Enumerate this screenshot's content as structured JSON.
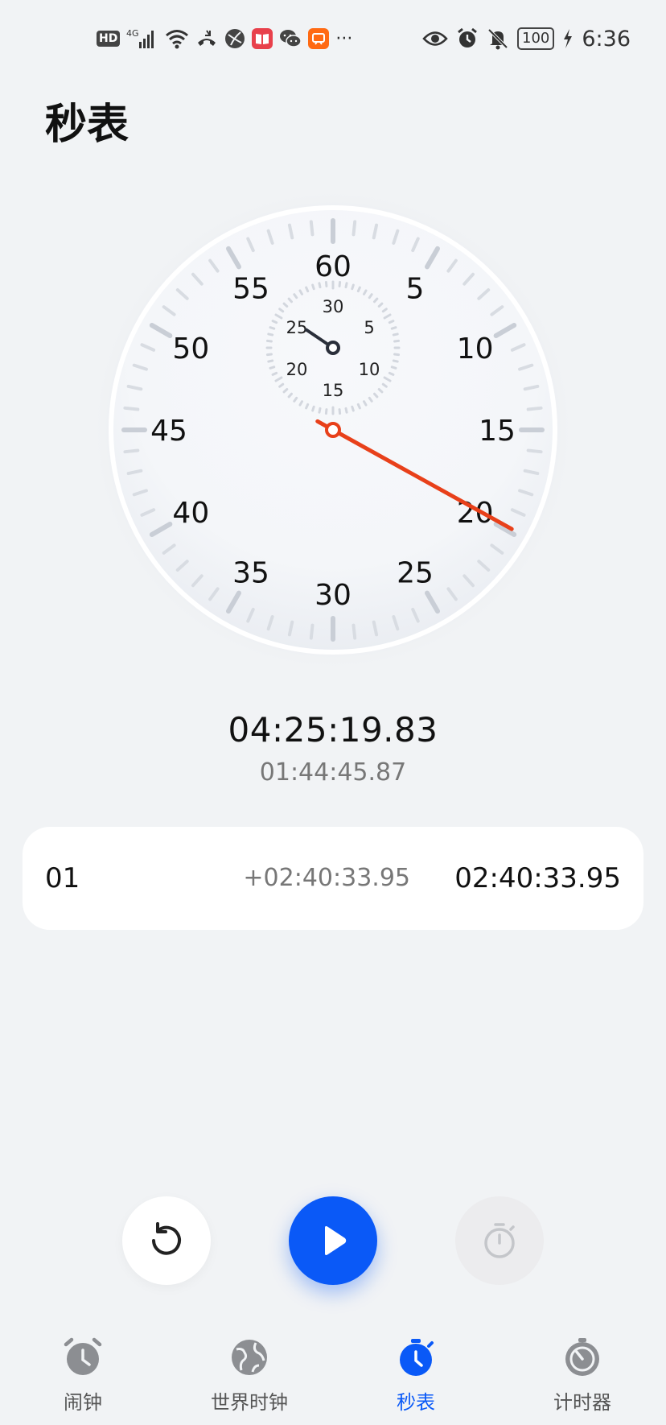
{
  "status_bar": {
    "left_icons": [
      "hd-icon",
      "4g-signal-icon",
      "wifi-icon",
      "call-icon",
      "browser-icon",
      "reader-app-icon",
      "wechat-icon",
      "taobao-icon",
      "more-icon"
    ],
    "hd_label": "HD",
    "net_label": "4G",
    "more_label": "···",
    "battery": "100",
    "time": "6:36"
  },
  "page": {
    "title": "秒表"
  },
  "dial": {
    "outer_labels": [
      "60",
      "5",
      "10",
      "15",
      "20",
      "25",
      "30",
      "35",
      "40",
      "45",
      "50",
      "55"
    ],
    "inner_labels": [
      "30",
      "5",
      "10",
      "15",
      "20",
      "25"
    ],
    "second_hand_seconds": 19.83,
    "minute_hand_minutes": 25.33
  },
  "readout": {
    "total": "04:25:19.83",
    "current_lap": "01:44:45.87"
  },
  "laps": [
    {
      "index": "01",
      "diff": "+02:40:33.95",
      "total": "02:40:33.95"
    }
  ],
  "controls": {
    "reset_icon": "reset-icon",
    "play_icon": "play-icon",
    "lap_icon": "stopwatch-icon"
  },
  "tabs": [
    {
      "label": "闹钟",
      "icon": "alarm-clock-icon",
      "active": false
    },
    {
      "label": "世界时钟",
      "icon": "globe-icon",
      "active": false
    },
    {
      "label": "秒表",
      "icon": "stopwatch-icon",
      "active": true
    },
    {
      "label": "计时器",
      "icon": "timer-icon",
      "active": false
    }
  ],
  "colors": {
    "accent": "#0a59f7",
    "hand": "#e8401a"
  }
}
